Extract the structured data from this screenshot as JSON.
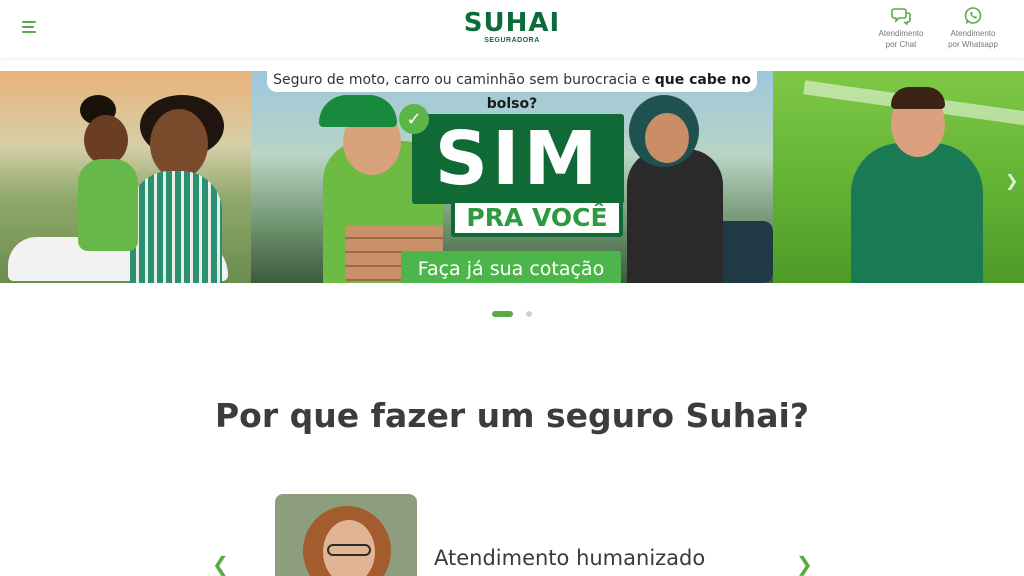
{
  "header": {
    "menu_icon": "hamburger-menu-icon",
    "logo": {
      "name": "SUHAI",
      "subtitle": "SEGURADORA"
    },
    "contacts": [
      {
        "icon": "chat-icon",
        "line1": "Atendimento",
        "line2": "por Chat"
      },
      {
        "icon": "whatsapp-icon",
        "line1": "Atendimento",
        "line2": "por Whatsapp"
      }
    ]
  },
  "banner": {
    "tagline_plain": "Seguro de moto, carro ou caminhão sem burocracia e ",
    "tagline_bold": "que cabe no bolso?",
    "headline": "SIM",
    "subheadline": "PRA VOCÊ",
    "cta": "Faça já sua cotação",
    "next_icon": "chevron-right-icon"
  },
  "carousel_dots": {
    "total": 2,
    "active": 1
  },
  "section": {
    "title": "Por que fazer um seguro Suhai?",
    "card_title": "Atendimento humanizado",
    "prev_icon": "chevron-left-icon",
    "next_icon": "chevron-right-icon"
  },
  "colors": {
    "brand_green": "#0b6b3a",
    "accent_green": "#5aaa48",
    "cta_green": "#4db64a"
  }
}
